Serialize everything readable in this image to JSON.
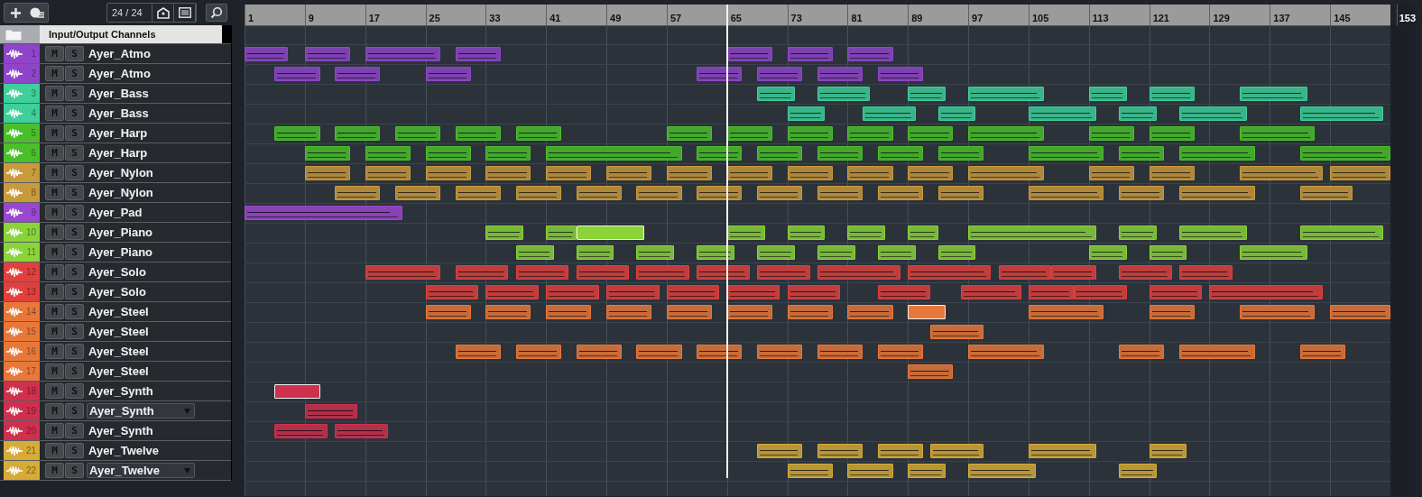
{
  "toolbar": {
    "track_counter": "24 / 24"
  },
  "ruler": {
    "bars": [
      "1",
      "9",
      "17",
      "25",
      "33",
      "41",
      "49",
      "57",
      "65",
      "73",
      "81",
      "89",
      "97",
      "105",
      "113",
      "121",
      "129",
      "137",
      "145",
      "153"
    ]
  },
  "folder_track": {
    "name": "Input/Output Channels"
  },
  "tracks": [
    {
      "number": "1",
      "name": "Ayer_Atmo",
      "kind": "plain",
      "color": "#8f45c9",
      "mute": "M",
      "solo": "S",
      "clips": [
        {
          "selected": false
        },
        {
          "selected": false
        },
        {
          "selected": false
        },
        {
          "selected": false
        },
        {
          "selected": false
        },
        {
          "selected": false
        },
        {
          "selected": false
        }
      ]
    },
    {
      "number": "2",
      "name": "Ayer_Atmo",
      "kind": "plain",
      "color": "#8f45c9",
      "mute": "M",
      "solo": "S",
      "clips": [
        {
          "selected": false
        },
        {
          "selected": false
        },
        {
          "selected": false
        },
        {
          "selected": false
        },
        {
          "selected": false
        },
        {
          "selected": false
        },
        {
          "selected": false
        }
      ]
    },
    {
      "number": "3",
      "name": "Ayer_Bass",
      "kind": "plain",
      "color": "#3fcf9a",
      "mute": "M",
      "solo": "S",
      "clips": [
        {
          "selected": false
        },
        {
          "selected": false
        },
        {
          "selected": false
        },
        {
          "selected": false
        },
        {
          "selected": false
        },
        {
          "selected": false
        },
        {
          "selected": false
        }
      ]
    },
    {
      "number": "4",
      "name": "Ayer_Bass",
      "kind": "plain",
      "color": "#3fcf9a",
      "mute": "M",
      "solo": "S",
      "clips": [
        {
          "selected": false
        },
        {
          "selected": false
        },
        {
          "selected": false
        },
        {
          "selected": false
        },
        {
          "selected": false
        },
        {
          "selected": false
        },
        {
          "selected": false
        }
      ]
    },
    {
      "number": "5",
      "name": "Ayer_Harp",
      "kind": "plain",
      "color": "#4bbf2b",
      "mute": "M",
      "solo": "S",
      "clips": [
        {
          "selected": false
        },
        {
          "selected": false
        },
        {
          "selected": false
        },
        {
          "selected": false
        },
        {
          "selected": false
        },
        {
          "selected": false
        },
        {
          "selected": false
        },
        {
          "selected": false
        },
        {
          "selected": false
        },
        {
          "selected": false
        },
        {
          "selected": false
        },
        {
          "selected": false
        },
        {
          "selected": false
        },
        {
          "selected": false
        }
      ]
    },
    {
      "number": "6",
      "name": "Ayer_Harp",
      "kind": "plain",
      "color": "#4bbf2b",
      "mute": "M",
      "solo": "S",
      "clips": [
        {
          "selected": false
        },
        {
          "selected": false
        },
        {
          "selected": false
        },
        {
          "selected": false
        },
        {
          "selected": false
        },
        {
          "selected": false
        },
        {
          "selected": false
        },
        {
          "selected": false
        },
        {
          "selected": false
        },
        {
          "selected": false
        },
        {
          "selected": false
        },
        {
          "selected": false
        },
        {
          "selected": false
        },
        {
          "selected": false
        }
      ]
    },
    {
      "number": "7",
      "name": "Ayer_Nylon",
      "kind": "plain",
      "color": "#c99a3c",
      "mute": "M",
      "solo": "S",
      "clips": [
        {
          "selected": false
        },
        {
          "selected": false
        },
        {
          "selected": false
        },
        {
          "selected": false
        },
        {
          "selected": false
        },
        {
          "selected": false
        },
        {
          "selected": false
        },
        {
          "selected": false
        },
        {
          "selected": false
        },
        {
          "selected": false
        },
        {
          "selected": false
        },
        {
          "selected": false
        },
        {
          "selected": false
        },
        {
          "selected": false
        },
        {
          "selected": false
        },
        {
          "selected": false
        }
      ]
    },
    {
      "number": "8",
      "name": "Ayer_Nylon",
      "kind": "plain",
      "color": "#c99a3c",
      "mute": "M",
      "solo": "S",
      "clips": [
        {
          "selected": false
        },
        {
          "selected": false
        },
        {
          "selected": false
        },
        {
          "selected": false
        },
        {
          "selected": false
        },
        {
          "selected": false
        },
        {
          "selected": false
        },
        {
          "selected": false
        },
        {
          "selected": false
        },
        {
          "selected": false
        },
        {
          "selected": false
        },
        {
          "selected": false
        },
        {
          "selected": false
        },
        {
          "selected": false
        },
        {
          "selected": false
        }
      ]
    },
    {
      "number": "9",
      "name": "Ayer_Pad",
      "kind": "plain",
      "color": "#9b47d0",
      "mute": "M",
      "solo": "S",
      "clips": [
        {
          "selected": false
        }
      ]
    },
    {
      "number": "10",
      "name": "Ayer_Piano",
      "kind": "plain",
      "color": "#8ad43a",
      "mute": "M",
      "solo": "S",
      "clips": [
        {
          "selected": false
        },
        {
          "selected": false
        },
        {
          "selected": true
        },
        {
          "selected": false
        },
        {
          "selected": false
        },
        {
          "selected": false
        },
        {
          "selected": false
        },
        {
          "selected": false
        },
        {
          "selected": false
        },
        {
          "selected": false
        },
        {
          "selected": false
        }
      ]
    },
    {
      "number": "11",
      "name": "Ayer_Piano",
      "kind": "plain",
      "color": "#8ad43a",
      "mute": "M",
      "solo": "S",
      "clips": [
        {
          "selected": false
        },
        {
          "selected": false
        },
        {
          "selected": false
        },
        {
          "selected": false
        },
        {
          "selected": false
        },
        {
          "selected": false
        },
        {
          "selected": false
        },
        {
          "selected": false
        },
        {
          "selected": false
        },
        {
          "selected": false
        },
        {
          "selected": false
        }
      ]
    },
    {
      "number": "12",
      "name": "Ayer_Solo",
      "kind": "plain",
      "color": "#e0403e",
      "mute": "M",
      "solo": "S",
      "clips": [
        {
          "selected": false
        },
        {
          "selected": false
        },
        {
          "selected": false
        },
        {
          "selected": false
        },
        {
          "selected": false
        },
        {
          "selected": false
        },
        {
          "selected": false
        },
        {
          "selected": false
        },
        {
          "selected": false
        },
        {
          "selected": false
        },
        {
          "selected": false
        },
        {
          "selected": false
        },
        {
          "selected": false
        }
      ]
    },
    {
      "number": "13",
      "name": "Ayer_Solo",
      "kind": "plain",
      "color": "#e0403e",
      "mute": "M",
      "solo": "S",
      "clips": [
        {
          "selected": false
        },
        {
          "selected": false
        },
        {
          "selected": false
        },
        {
          "selected": false
        },
        {
          "selected": false
        },
        {
          "selected": false
        },
        {
          "selected": false
        },
        {
          "selected": false
        },
        {
          "selected": false
        },
        {
          "selected": false
        },
        {
          "selected": false
        },
        {
          "selected": false
        },
        {
          "selected": false
        }
      ]
    },
    {
      "number": "14",
      "name": "Ayer_Steel",
      "kind": "plain",
      "color": "#e8783a",
      "mute": "M",
      "solo": "S",
      "clips": [
        {
          "selected": false
        },
        {
          "selected": false
        },
        {
          "selected": false
        },
        {
          "selected": false
        },
        {
          "selected": false
        },
        {
          "selected": false
        },
        {
          "selected": false
        },
        {
          "selected": false
        },
        {
          "selected": true
        },
        {
          "selected": false
        },
        {
          "selected": false
        },
        {
          "selected": false
        },
        {
          "selected": false
        }
      ]
    },
    {
      "number": "15",
      "name": "Ayer_Steel",
      "kind": "plain",
      "color": "#e8783a",
      "mute": "M",
      "solo": "S",
      "clips": [
        {
          "selected": false
        }
      ]
    },
    {
      "number": "16",
      "name": "Ayer_Steel",
      "kind": "plain",
      "color": "#e8783a",
      "mute": "M",
      "solo": "S",
      "clips": [
        {
          "selected": false
        },
        {
          "selected": false
        },
        {
          "selected": false
        },
        {
          "selected": false
        },
        {
          "selected": false
        },
        {
          "selected": false
        },
        {
          "selected": false
        },
        {
          "selected": false
        },
        {
          "selected": false
        },
        {
          "selected": false
        },
        {
          "selected": false
        },
        {
          "selected": false
        }
      ]
    },
    {
      "number": "17",
      "name": "Ayer_Steel",
      "kind": "plain",
      "color": "#e8783a",
      "mute": "M",
      "solo": "S",
      "clips": [
        {
          "selected": false
        }
      ]
    },
    {
      "number": "18",
      "name": "Ayer_Synth",
      "kind": "plain",
      "color": "#cf304e",
      "mute": "M",
      "solo": "S",
      "clips": [
        {
          "selected": true
        }
      ]
    },
    {
      "number": "19",
      "name": "Ayer_Synth",
      "kind": "dropdown",
      "color": "#cf304e",
      "mute": "M",
      "solo": "S",
      "clips": [
        {
          "selected": false
        }
      ]
    },
    {
      "number": "20",
      "name": "Ayer_Synth",
      "kind": "plain",
      "color": "#cf304e",
      "mute": "M",
      "solo": "S",
      "clips": [
        {
          "selected": false
        },
        {
          "selected": false
        }
      ]
    },
    {
      "number": "21",
      "name": "Ayer_Twelve",
      "kind": "plain",
      "color": "#d6ab38",
      "mute": "M",
      "solo": "S",
      "clips": [
        {
          "selected": false
        },
        {
          "selected": false
        },
        {
          "selected": false
        },
        {
          "selected": false
        },
        {
          "selected": false
        },
        {
          "selected": false
        }
      ]
    },
    {
      "number": "22",
      "name": "Ayer_Twelve",
      "kind": "dropdown",
      "color": "#d6ab38",
      "mute": "M",
      "solo": "S",
      "clips": [
        {
          "selected": false
        },
        {
          "selected": false
        },
        {
          "selected": false
        },
        {
          "selected": false
        },
        {
          "selected": false
        }
      ]
    }
  ]
}
